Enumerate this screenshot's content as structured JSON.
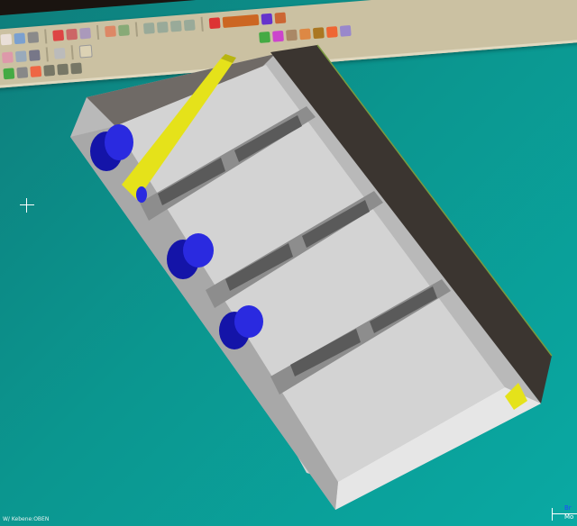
{
  "status_bar": {
    "view_label": "W/ Kebene:OBEN"
  },
  "scale_indicator": {
    "top_label": "Br",
    "bottom_label": "Mo"
  },
  "toolbar": {
    "icons": [
      "view-front-icon",
      "view-top-icon",
      "view-iso-icon",
      "render-icon",
      "shade-icon",
      "wireframe-icon",
      "hidden-line-icon",
      "point-icon",
      "line-icon",
      "arc-icon",
      "fillet-icon",
      "chamfer-icon",
      "move-icon",
      "rotate-icon",
      "layer-icon",
      "color-icon"
    ]
  },
  "colors": {
    "background": "#0b968f",
    "part_gray": "#c9c9c9",
    "rib_gray": "#8d8d8d",
    "wall_dark": "#3b3530",
    "accent_yellow": "#e5e21a",
    "feature_blue": "#1a1acc",
    "toolbar": "#cbc1a2"
  }
}
